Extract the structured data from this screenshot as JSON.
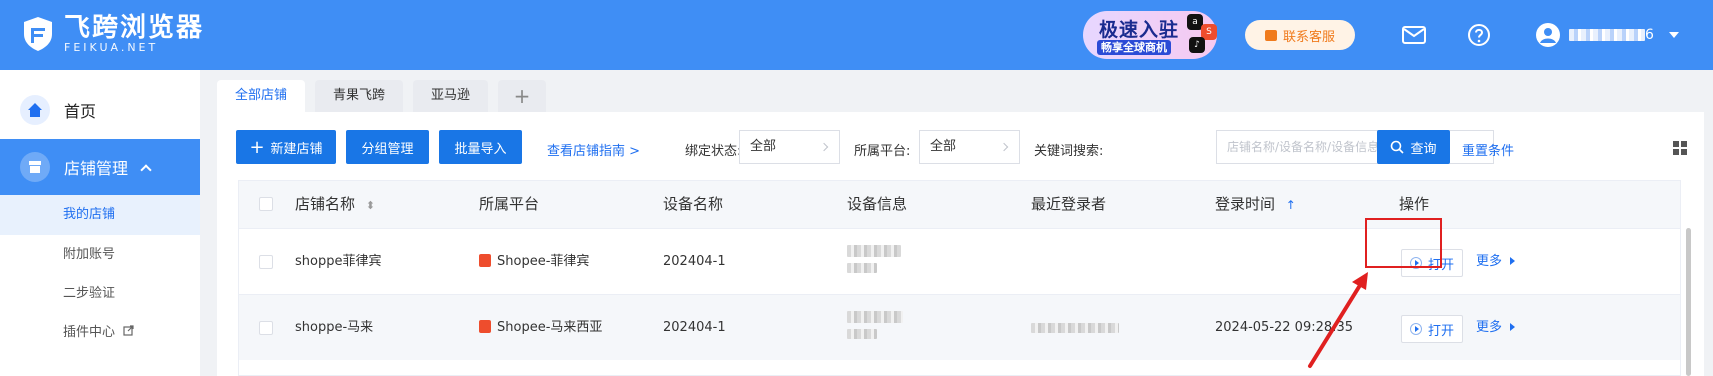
{
  "header": {
    "logo_title": "飞跨浏览器",
    "logo_sub": "FEIKUA.NET",
    "promo_title": "极速入驻",
    "promo_sub": "畅享全球商机",
    "service_label": "联系客服",
    "user_suffix": "6",
    "icons": [
      "mail-icon",
      "help-icon",
      "user-avatar-icon",
      "chevron-down-icon"
    ]
  },
  "sidebar": {
    "home_label": "首页",
    "store_label": "店铺管理",
    "sub_items": [
      "我的店铺",
      "附加账号",
      "二步验证",
      "插件中心"
    ]
  },
  "tabs": [
    "全部店铺",
    "青果飞跨",
    "亚马逊"
  ],
  "toolbar": {
    "new_store": "新建店铺",
    "group_manage": "分组管理",
    "batch_import": "批量导入",
    "guide_link": "查看店铺指南 >",
    "bind_status_label": "绑定状态:",
    "bind_status_value": "全部",
    "platform_label": "所属平台:",
    "platform_value": "全部",
    "keyword_label": "关键词搜索:",
    "keyword_placeholder": "店铺名称/设备名称/设备信息/店铺账号",
    "search_button": "查询",
    "reset_link": "重置条件"
  },
  "table": {
    "columns": [
      "店铺名称",
      "所属平台",
      "设备名称",
      "设备信息",
      "最近登录者",
      "登录时间",
      "操作"
    ],
    "rows": [
      {
        "name": "shoppe菲律宾",
        "platform": "Shopee-菲律宾",
        "device": "202404-1",
        "login_time": "",
        "open": "打开",
        "more": "更多"
      },
      {
        "name": "shoppe-马来",
        "platform": "Shopee-马来西亚",
        "device": "202404-1",
        "login_time": "2024-05-22 09:28:35",
        "open": "打开",
        "more": "更多"
      }
    ]
  },
  "colors": {
    "header_bg": "#3f8ef5",
    "primary_button": "#1976e6",
    "link": "#1f6ff0",
    "service_text": "#f07b1d",
    "highlight": "#e02020"
  }
}
